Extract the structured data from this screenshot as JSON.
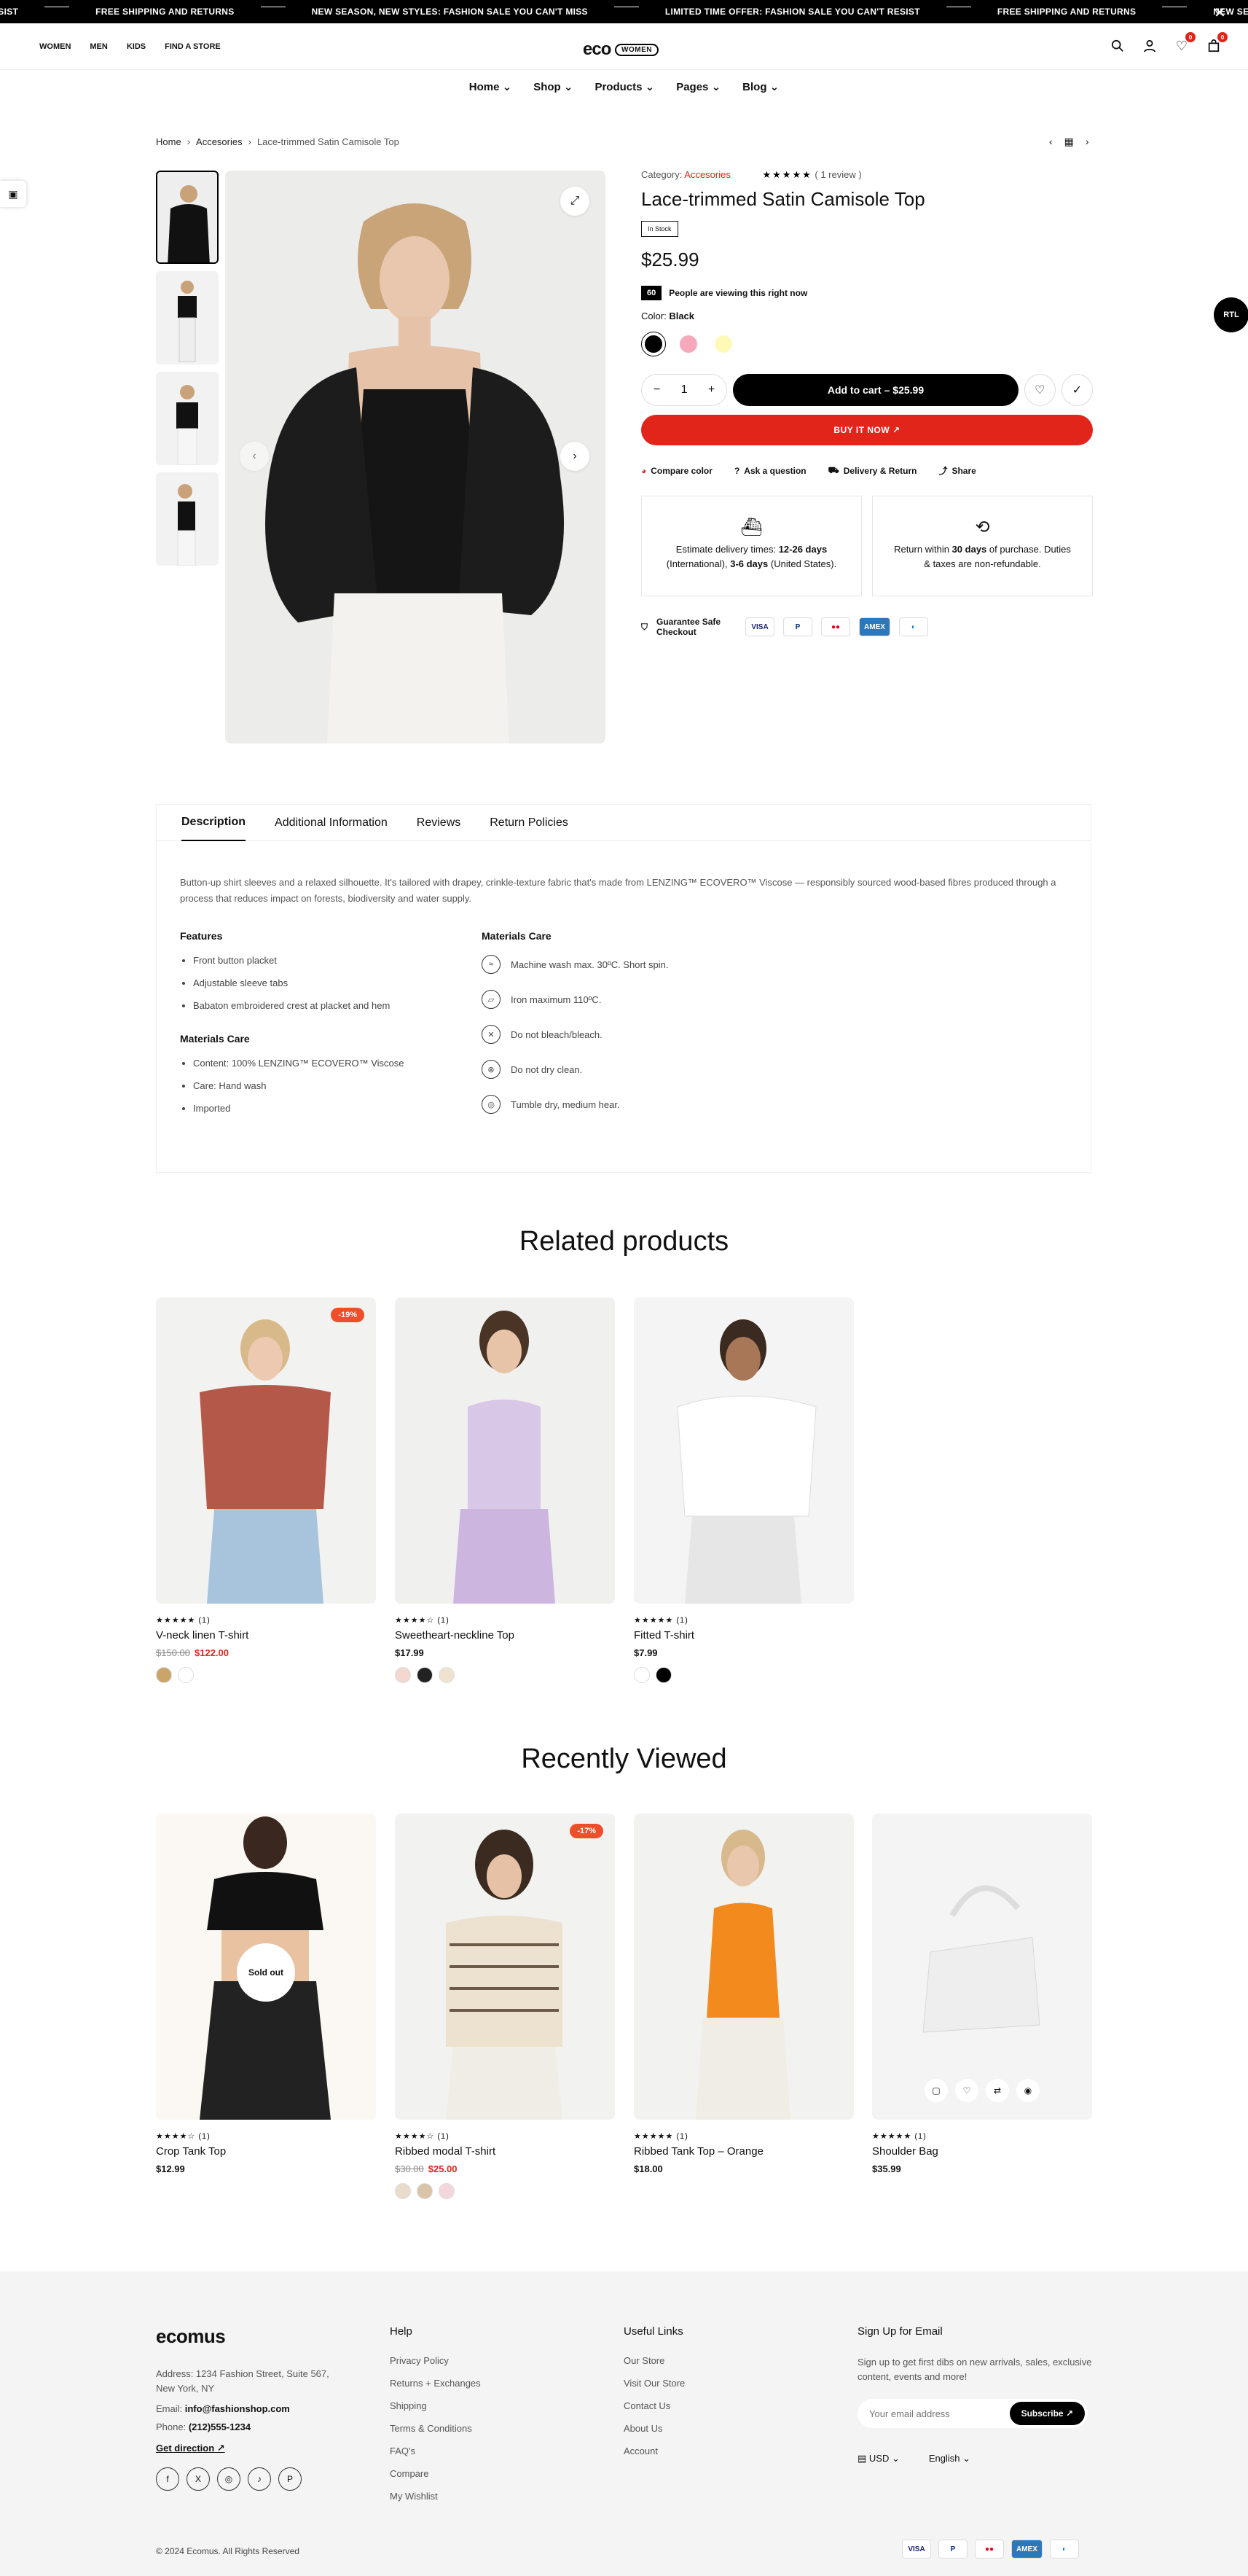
{
  "ticker": {
    "items": [
      "FREE SHIPPING AND RETURNS",
      "NEW SEASON, NEW STYLES: FASHION SALE YOU CAN'T MISS",
      "LIMITED TIME OFFER: FASHION SALE YOU CAN'T RESIST",
      "FREE SHIPPING AND RETURNS",
      "NEW SEASON, NEW STYLES: FASHION SALE YOU CAN'T MISS"
    ],
    "start": "RESIST"
  },
  "header": {
    "links": [
      "WOMEN",
      "MEN",
      "KIDS",
      "FIND A STORE"
    ],
    "logo": "eco",
    "logo_pill": "WOMEN",
    "wishlist_count": "0",
    "cart_count": "0"
  },
  "nav": [
    "Home",
    "Shop",
    "Products",
    "Pages",
    "Blog"
  ],
  "breadcrumb": [
    "Home",
    "Accesories",
    "Lace-trimmed Satin Camisole Top"
  ],
  "rtl_label": "RTL",
  "product": {
    "category_label": "Category:",
    "category": "Accesories",
    "stars": "★★★★★",
    "review": "( 1 review )",
    "title": "Lace-trimmed Satin Camisole Top",
    "tag": "In Stock",
    "price": "$25.99",
    "viewing_count": "60",
    "viewing_text": "People are viewing this right now",
    "color_label": "Color:",
    "color_value": "Black",
    "qty": "1",
    "add_cart": "Add to cart",
    "add_cart_price": "$25.99",
    "buy_now": "BUY IT NOW",
    "actions": [
      "Compare color",
      "Ask a question",
      "Delivery & Return",
      "Share"
    ],
    "delivery_pre": "Estimate delivery times:",
    "delivery_intl": "12-26 days",
    "delivery_mid": "(International),",
    "delivery_us": "3-6 days",
    "delivery_post": "(United States).",
    "return_pre": "Return within",
    "return_days": "30 days",
    "return_post": "of purchase. Duties & taxes are non-refundable.",
    "checkout": "Guarantee Safe Checkout",
    "cards": [
      "VISA",
      "P",
      "●●",
      "AMEX",
      "◐"
    ],
    "colors": [
      "#000000",
      "#f7a8bd",
      "#fff9b8"
    ]
  },
  "tabs": {
    "labels": [
      "Description",
      "Additional Information",
      "Reviews",
      "Return Policies"
    ],
    "description": "Button-up shirt sleeves and a relaxed silhouette. It's tailored with drapey, crinkle-texture fabric that's made from LENZING™ ECOVERO™ Viscose — responsibly sourced wood-based fibres produced through a process that reduces impact on forests, biodiversity and water supply.",
    "features_title": "Features",
    "features": [
      "Front button placket",
      "Adjustable sleeve tabs",
      "Babaton embroidered crest at placket and hem"
    ],
    "materials_title": "Materials Care",
    "materials": [
      "Content: 100% LENZING™ ECOVERO™ Viscose",
      "Care: Hand wash",
      "Imported"
    ],
    "care_title": "Materials Care",
    "care": [
      "Machine wash max. 30ºC. Short spin.",
      "Iron maximum 110ºC.",
      "Do not bleach/bleach.",
      "Do not dry clean.",
      "Tumble dry, medium hear."
    ]
  },
  "related": {
    "title": "Related products",
    "items": [
      {
        "stars": "★★★★★",
        "count": "(1)",
        "name": "V-neck linen T-shirt",
        "old": "$150.00",
        "price": "$122.00",
        "badge": "-19%"
      },
      {
        "stars": "★★★★☆",
        "count": "(1)",
        "name": "Sweetheart-neckline Top",
        "price": "$17.99"
      },
      {
        "stars": "★★★★★",
        "count": "(1)",
        "name": "Fitted T-shirt",
        "price": "$7.99"
      }
    ]
  },
  "recent": {
    "title": "Recently Viewed",
    "items": [
      {
        "stars": "★★★★☆",
        "count": "(1)",
        "name": "Crop Tank Top",
        "price": "$12.99",
        "sold": "Sold out"
      },
      {
        "stars": "★★★★☆",
        "count": "(1)",
        "name": "Ribbed modal T-shirt",
        "old": "$30.00",
        "price": "$25.00",
        "badge": "-17%"
      },
      {
        "stars": "★★★★★",
        "count": "(1)",
        "name": "Ribbed Tank Top – Orange",
        "price": "$18.00"
      },
      {
        "stars": "★★★★★",
        "count": "(1)",
        "name": "Shoulder Bag",
        "price": "$35.99"
      }
    ]
  },
  "footer": {
    "logo": "ecomus",
    "address": "Address: 1234 Fashion Street, Suite 567, New York, NY",
    "email_label": "Email:",
    "email": "info@fashionshop.com",
    "phone_label": "Phone:",
    "phone": "(212)555-1234",
    "direction": "Get direction",
    "help_title": "Help",
    "help": [
      "Privacy Policy",
      "Returns + Exchanges",
      "Shipping",
      "Terms & Conditions",
      "FAQ's",
      "Compare",
      "My Wishlist"
    ],
    "links_title": "Useful Links",
    "links": [
      "Our Store",
      "Visit Our Store",
      "Contact Us",
      "About Us",
      "Account"
    ],
    "signup_title": "Sign Up for Email",
    "signup_text": "Sign up to get first dibs on new arrivals, sales, exclusive content, events and more!",
    "email_placeholder": "Your email address",
    "subscribe": "Subscribe",
    "currency": "USD",
    "language": "English",
    "copyright": "© 2024 Ecomus. All Rights Reserved"
  }
}
